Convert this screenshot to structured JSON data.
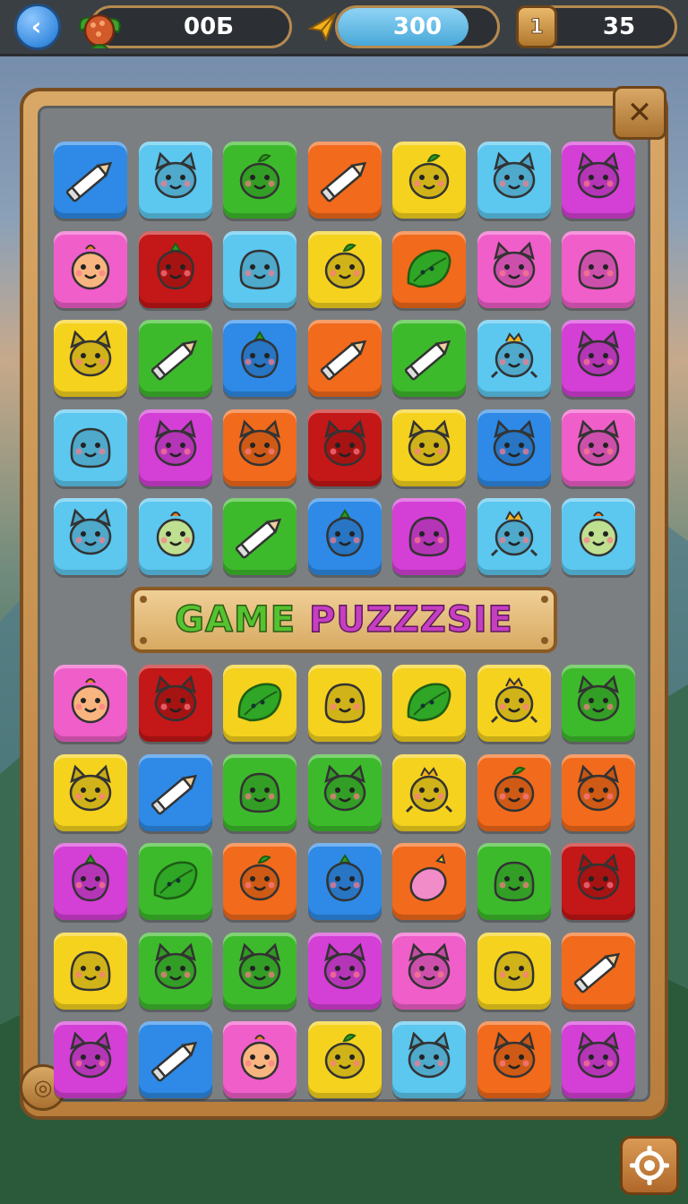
{
  "topbar": {
    "back_icon": "chevron-left-icon",
    "fruit_icon": "fruit-icon",
    "fruit_count": "00Ƃ",
    "energy_icon": "paper-plane-icon",
    "energy_value": "300",
    "energy_fill": 0.82,
    "level_icon": "level-badge-icon",
    "level_badge_text": "1",
    "level_value": "35"
  },
  "banner": {
    "part1": "GAME ",
    "part2": "PUZZZSIE"
  },
  "close_icon": "close-icon",
  "settings_icon": "gear-icon",
  "colors": {
    "blue": "#2e8ae6",
    "cyan": "#5cc7ef",
    "green": "#3dba2c",
    "red": "#e0221c",
    "orange": "#f26a1b",
    "yellow": "#f5d21e",
    "magenta": "#d43fd6",
    "pink": "#f05ec9",
    "darkred": "#c41717"
  },
  "grid_top": [
    [
      {
        "c": "blue",
        "i": "pencil"
      },
      {
        "c": "cyan",
        "i": "cat"
      },
      {
        "c": "green",
        "i": "fruit-face"
      },
      {
        "c": "orange",
        "i": "pencil"
      },
      {
        "c": "yellow",
        "i": "fruit-face"
      },
      {
        "c": "cyan",
        "i": "cat"
      },
      {
        "c": "magenta",
        "i": "cat"
      }
    ],
    [
      {
        "c": "pink",
        "i": "chick"
      },
      {
        "c": "darkred",
        "i": "berry-face"
      },
      {
        "c": "cyan",
        "i": "blob"
      },
      {
        "c": "yellow",
        "i": "fruit-face"
      },
      {
        "c": "orange",
        "i": "leaf"
      },
      {
        "c": "pink",
        "i": "cat"
      },
      {
        "c": "pink",
        "i": "blob"
      }
    ],
    [
      {
        "c": "yellow",
        "i": "cat"
      },
      {
        "c": "green",
        "i": "pencil"
      },
      {
        "c": "blue",
        "i": "berry-face"
      },
      {
        "c": "orange",
        "i": "pencil"
      },
      {
        "c": "green",
        "i": "pencil"
      },
      {
        "c": "cyan",
        "i": "dino"
      },
      {
        "c": "magenta",
        "i": "cat"
      }
    ],
    [
      {
        "c": "cyan",
        "i": "blob"
      },
      {
        "c": "magenta",
        "i": "cat"
      },
      {
        "c": "orange",
        "i": "cat"
      },
      {
        "c": "darkred",
        "i": "cat"
      },
      {
        "c": "yellow",
        "i": "cat"
      },
      {
        "c": "blue",
        "i": "cat"
      },
      {
        "c": "pink",
        "i": "cat"
      }
    ],
    [
      {
        "c": "cyan",
        "i": "cat"
      },
      {
        "c": "cyan",
        "i": "chick"
      },
      {
        "c": "green",
        "i": "pencil"
      },
      {
        "c": "blue",
        "i": "berry-face"
      },
      {
        "c": "magenta",
        "i": "blob"
      },
      {
        "c": "cyan",
        "i": "dino"
      },
      {
        "c": "cyan",
        "i": "chick"
      }
    ]
  ],
  "grid_bottom": [
    [
      {
        "c": "pink",
        "i": "chick"
      },
      {
        "c": "darkred",
        "i": "cat"
      },
      {
        "c": "yellow",
        "i": "leaf"
      },
      {
        "c": "yellow",
        "i": "blob"
      },
      {
        "c": "yellow",
        "i": "leaf"
      },
      {
        "c": "yellow",
        "i": "dino"
      },
      {
        "c": "green",
        "i": "cat"
      }
    ],
    [
      {
        "c": "yellow",
        "i": "cat"
      },
      {
        "c": "blue",
        "i": "pencil"
      },
      {
        "c": "green",
        "i": "blob"
      },
      {
        "c": "green",
        "i": "cat"
      },
      {
        "c": "yellow",
        "i": "dino"
      },
      {
        "c": "orange",
        "i": "fruit-face"
      },
      {
        "c": "orange",
        "i": "cat"
      }
    ],
    [
      {
        "c": "magenta",
        "i": "berry-face"
      },
      {
        "c": "green",
        "i": "leaf"
      },
      {
        "c": "orange",
        "i": "fruit-face"
      },
      {
        "c": "blue",
        "i": "berry-face"
      },
      {
        "c": "orange",
        "i": "berry"
      },
      {
        "c": "green",
        "i": "blob"
      },
      {
        "c": "darkred",
        "i": "cat"
      }
    ],
    [
      {
        "c": "yellow",
        "i": "blob"
      },
      {
        "c": "green",
        "i": "cat"
      },
      {
        "c": "green",
        "i": "cat"
      },
      {
        "c": "magenta",
        "i": "cat"
      },
      {
        "c": "pink",
        "i": "cat"
      },
      {
        "c": "yellow",
        "i": "blob"
      },
      {
        "c": "orange",
        "i": "pencil"
      }
    ],
    [
      {
        "c": "magenta",
        "i": "cat"
      },
      {
        "c": "blue",
        "i": "pencil"
      },
      {
        "c": "pink",
        "i": "chick"
      },
      {
        "c": "yellow",
        "i": "fruit-face"
      },
      {
        "c": "cyan",
        "i": "cat"
      },
      {
        "c": "orange",
        "i": "cat"
      },
      {
        "c": "magenta",
        "i": "cat"
      }
    ]
  ]
}
